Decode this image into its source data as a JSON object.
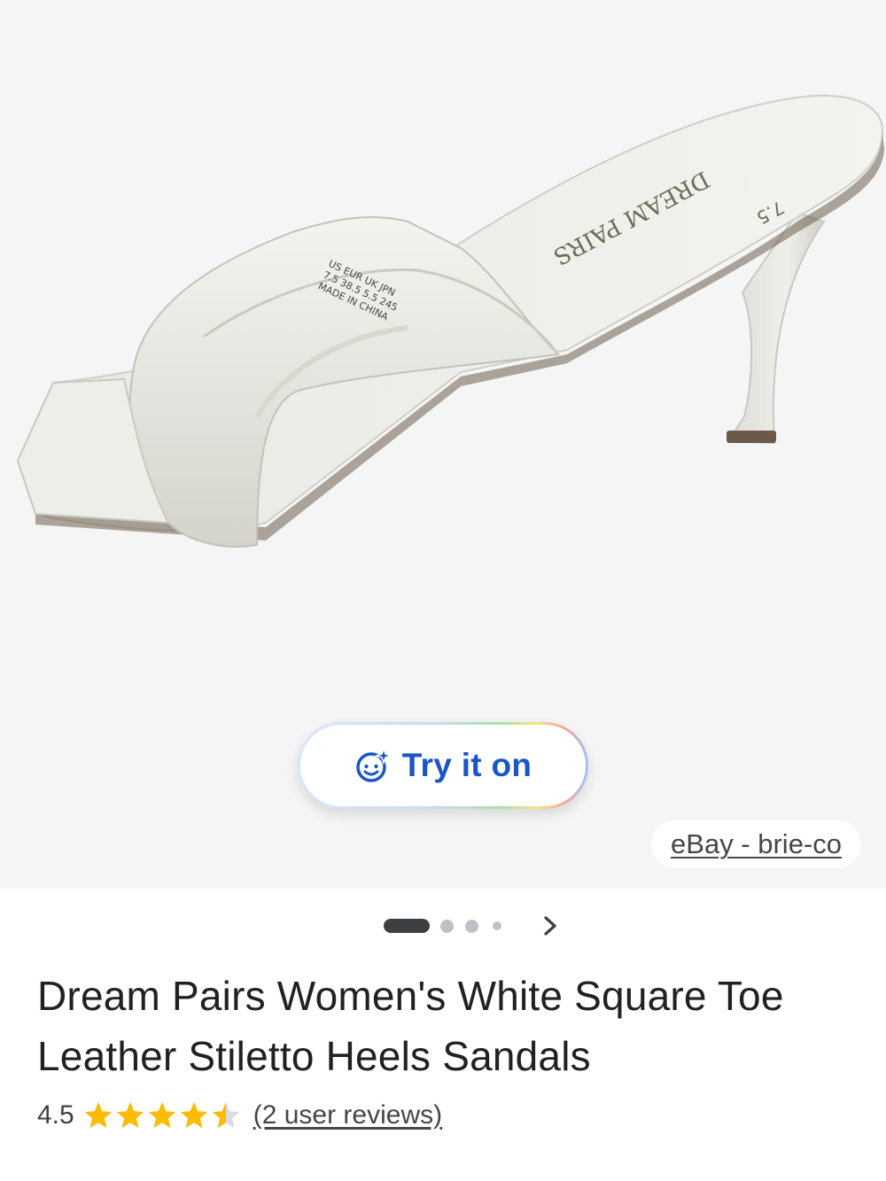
{
  "product": {
    "image_alt": "White square toe stiletto heel sandal",
    "insole_brand": "DREAM PAIRS",
    "insole_size": "7.5",
    "label_text": "US EUR UK JPN",
    "label_sizes": "7.5 38.5 5.5 245",
    "label_origin": "MADE IN CHINA",
    "try_on_label": "Try it on",
    "source": "eBay - brie-co",
    "title": "Dream Pairs Women's White Square Toe Leather Stiletto Heels Sandals",
    "rating": 4.5,
    "rating_text": "4.5",
    "reviews_text": "(2 user reviews)"
  },
  "carousel": {
    "total": 4,
    "active_index": 0
  },
  "colors": {
    "try_on_blue": "#1a56c6",
    "star_gold": "#fbbc04",
    "star_empty": "#dadce0",
    "text_primary": "#202124",
    "hero_bg": "#f5f5f5"
  },
  "icons": {
    "try_on": "face-sparkle-icon",
    "next": "chevron-right-icon",
    "star": "star-icon"
  }
}
